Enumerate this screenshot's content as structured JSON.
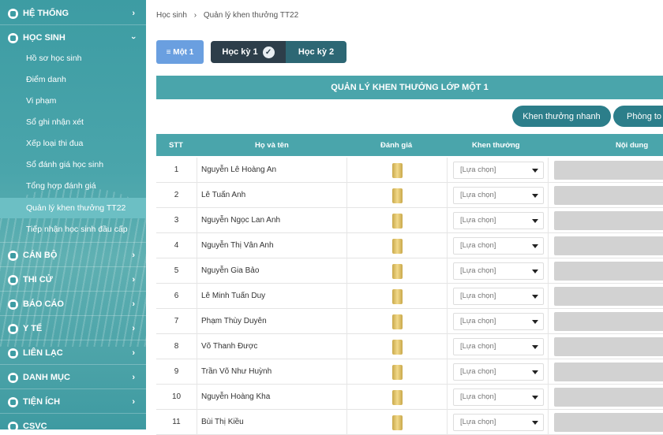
{
  "sidebar": {
    "he_thong": "HỆ THỐNG",
    "hoc_sinh": "HỌC SINH",
    "sub_items": [
      "Hồ sơ học sinh",
      "Điểm danh",
      "Vi phạm",
      "Sổ ghi nhận xét",
      "Xếp loại thi đua",
      "Sổ đánh giá học sinh",
      "Tổng hợp đánh giá",
      "Quản lý khen thưởng TT22",
      "Tiếp nhận học sinh đầu cấp"
    ],
    "can_bo": "CÁN BỘ",
    "thi_cu": "THI CỬ",
    "bao_cao": "BÁO CÁO",
    "y_te": "Y TẾ",
    "lien_lac": "LIÊN LẠC",
    "danh_muc": "DANH MỤC",
    "tien_ich": "TIỆN ÍCH",
    "csvc": "CSVC"
  },
  "breadcrumb": {
    "root": "Học sinh",
    "sep": "›",
    "current": "Quản lý khen thưởng TT22"
  },
  "class_button": "≡ Một 1",
  "semesters": {
    "hk1": "Học kỳ 1",
    "hk2": "Học kỳ 2",
    "check": "✓"
  },
  "page_title": "QUẢN LÝ KHEN THƯỞNG LỚP MỘT 1",
  "actions": {
    "quick_reward": "Khen thưởng nhanh",
    "second": "Phòng to"
  },
  "table": {
    "headers": {
      "stt": "STT",
      "name": "Họ và tên",
      "eval": "Đánh giá",
      "reward": "Khen thưởng",
      "content": "Nội dung"
    },
    "select_placeholder": "[Lựa chọn]",
    "rows": [
      {
        "stt": "1",
        "name": "Nguyễn Lê Hoàng An"
      },
      {
        "stt": "2",
        "name": "Lê Tuấn Anh"
      },
      {
        "stt": "3",
        "name": "Nguyễn Ngọc Lan Anh"
      },
      {
        "stt": "4",
        "name": "Nguyễn Thị Vân Anh"
      },
      {
        "stt": "5",
        "name": "Nguyễn Gia Bảo"
      },
      {
        "stt": "6",
        "name": "Lê Minh Tuấn Duy"
      },
      {
        "stt": "7",
        "name": "Phạm Thùy Duyên"
      },
      {
        "stt": "8",
        "name": "Võ Thanh Được"
      },
      {
        "stt": "9",
        "name": "Trần Võ Như Huỳnh"
      },
      {
        "stt": "10",
        "name": "Nguyễn Hoàng Kha"
      },
      {
        "stt": "11",
        "name": "Bùi Thị Kiều"
      }
    ]
  }
}
